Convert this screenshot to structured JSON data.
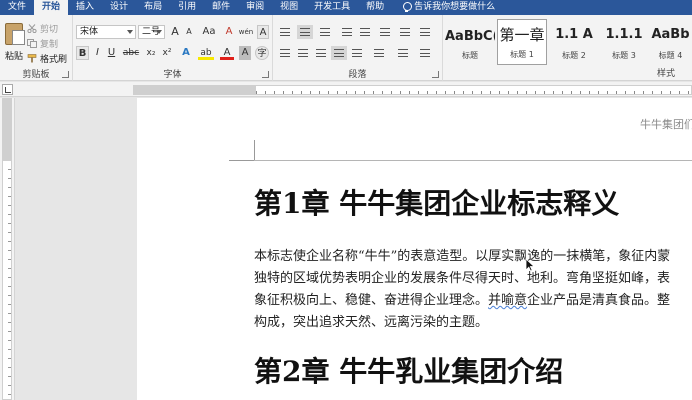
{
  "tabs": [
    {
      "label": "文件",
      "active": false
    },
    {
      "label": "开始",
      "active": true
    },
    {
      "label": "插入",
      "active": false
    },
    {
      "label": "设计",
      "active": false
    },
    {
      "label": "布局",
      "active": false
    },
    {
      "label": "引用",
      "active": false
    },
    {
      "label": "邮件",
      "active": false
    },
    {
      "label": "审阅",
      "active": false
    },
    {
      "label": "视图",
      "active": false
    },
    {
      "label": "开发工具",
      "active": false
    },
    {
      "label": "帮助",
      "active": false
    }
  ],
  "tell_me": "告诉我你想要做什么",
  "clipboard": {
    "label": "剪贴板",
    "paste": "粘贴",
    "cut": "剪切",
    "copy": "复制",
    "format_painter": "格式刷"
  },
  "font": {
    "label": "字体",
    "family": "宋体",
    "size": "二号",
    "grow": "A",
    "shrink": "A",
    "case": "Aa",
    "clear": "A",
    "phonetic": "wén",
    "border": "A",
    "bold": "B",
    "italic": "I",
    "underline": "U",
    "strike": "abc",
    "subscript": "x₂",
    "superscript": "x²",
    "effects": "A",
    "highlight": "ab",
    "color": "A",
    "shading": "A",
    "enclose": "字"
  },
  "paragraph": {
    "label": "段落"
  },
  "styles": {
    "label": "样式",
    "items": [
      {
        "sample": "AaBbC(",
        "name": "标题"
      },
      {
        "sample": "第一章",
        "name": "标题 1"
      },
      {
        "sample": "1.1 A",
        "name": "标题 2"
      },
      {
        "sample": "1.1.1",
        "name": "标题 3"
      },
      {
        "sample": "AaBb",
        "name": "标题 4"
      }
    ]
  },
  "document": {
    "header": "牛牛集团们",
    "heading1": "第1章  牛牛集团企业标志释义",
    "paragraph_lines": [
      "本标志使企业名称“牛牛”的表意造型。以厚实飘逸的一抹横笔，象征内蒙",
      "独特的区域优势表明企业的发展条件尽得天时、地利。弯角坚挺如峰，表",
      "象征积极向上、稳健、奋进得企业理念。",
      "构成，突出追求天然、远离污染的主题。"
    ],
    "line3_squiggle": "并喻意",
    "line3_tail": "企业产品是清真食品。整",
    "heading2": "第2章  牛牛乳业集团介绍"
  },
  "colors": {
    "accent": "#2b579a"
  }
}
